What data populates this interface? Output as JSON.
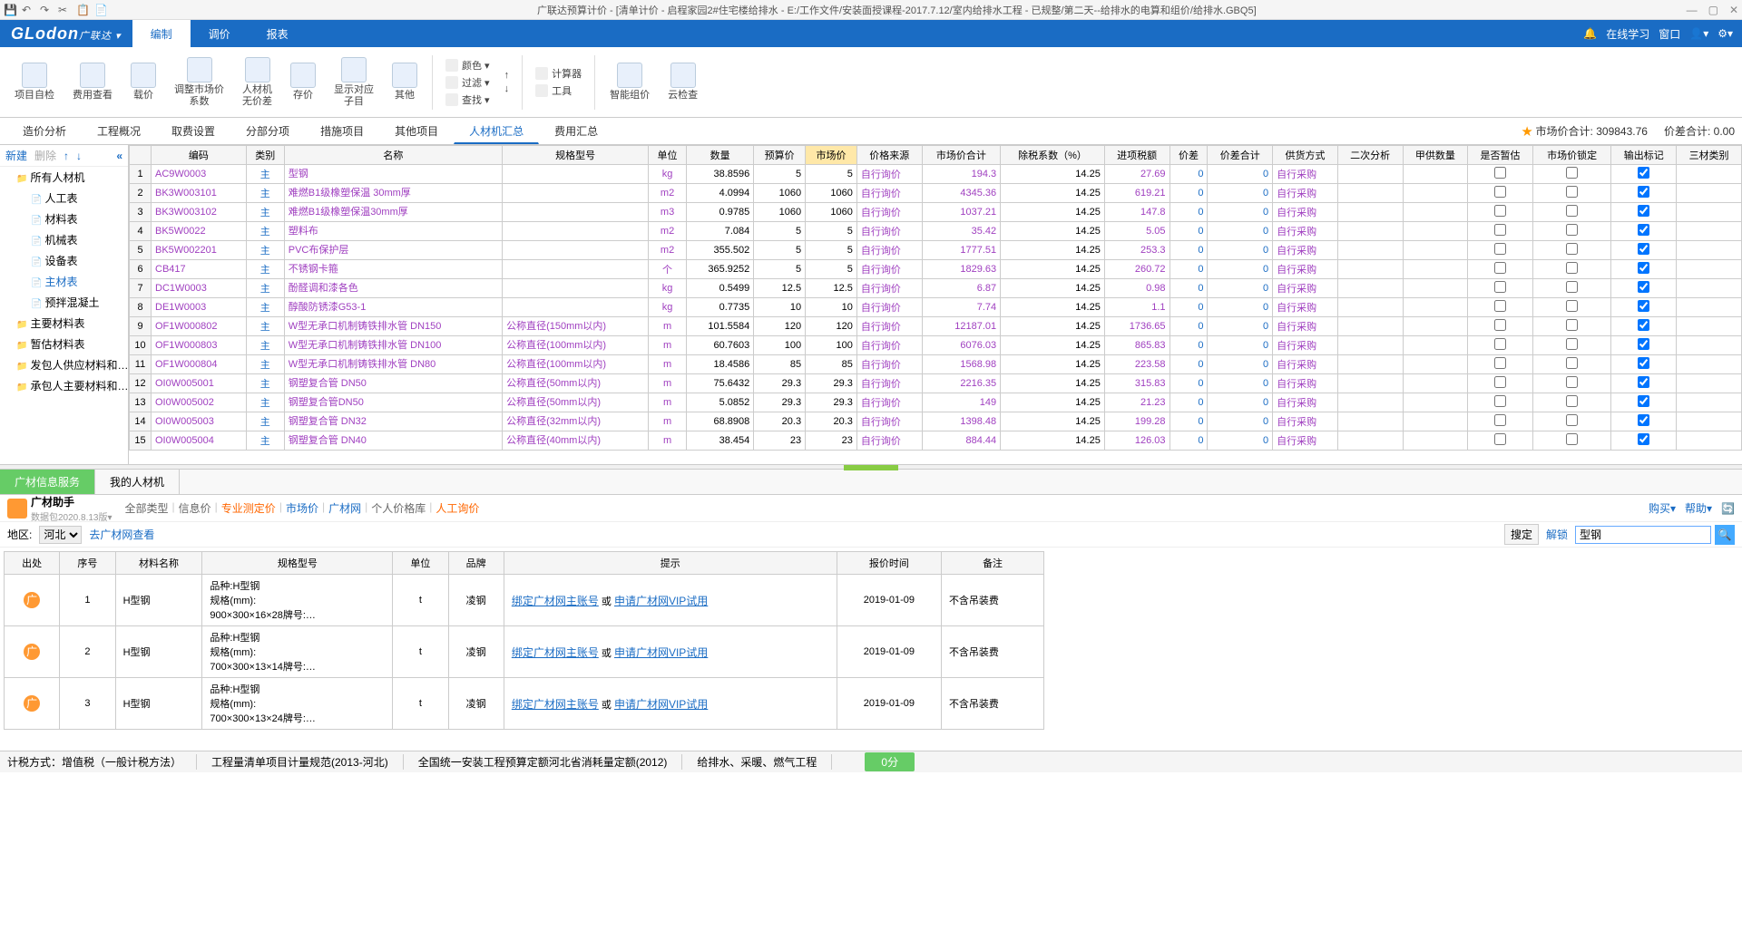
{
  "titlebar": {
    "title": "广联达预算计价 - [清单计价 - 启程家园2#住宅楼给排水 - E:/工作文件/安装面授课程-2017.7.12/室内给排水工程 - 已规整/第二天--给排水的电算和组价/给排水.GBQ5]"
  },
  "menu": {
    "tabs": [
      "编制",
      "调价",
      "报表"
    ],
    "active": 0,
    "right": {
      "online": "在线学习",
      "window": "窗口",
      "dropdown": "▾"
    }
  },
  "ribbon": {
    "buttons": [
      {
        "label": "项目自检"
      },
      {
        "label": "费用查看"
      },
      {
        "label": "载价"
      },
      {
        "label": "调整市场价\n系数"
      },
      {
        "label": "人材机\n无价差"
      },
      {
        "label": "存价"
      },
      {
        "label": "显示对应\n子目"
      },
      {
        "label": "其他"
      }
    ],
    "group2": [
      {
        "label": "颜色"
      },
      {
        "label": "过滤"
      },
      {
        "label": "查找"
      }
    ],
    "group3": [
      {
        "label": "计算器"
      },
      {
        "label": "工具"
      }
    ],
    "group4": [
      {
        "label": "智能组价"
      },
      {
        "label": "云检查"
      }
    ]
  },
  "subtabs": {
    "items": [
      "造价分析",
      "工程概况",
      "取费设置",
      "分部分项",
      "措施项目",
      "其他项目",
      "人材机汇总",
      "费用汇总"
    ],
    "active": 6,
    "totals": {
      "market_label": "市场价合计:",
      "market_value": "309843.76",
      "diff_label": "价差合计:",
      "diff_value": "0.00"
    }
  },
  "tree": {
    "toolbar": {
      "new": "新建",
      "del": "删除"
    },
    "nodes": [
      {
        "label": "所有人材机",
        "lvl": 0,
        "folder": true
      },
      {
        "label": "人工表",
        "lvl": 1
      },
      {
        "label": "材料表",
        "lvl": 1
      },
      {
        "label": "机械表",
        "lvl": 1
      },
      {
        "label": "设备表",
        "lvl": 1
      },
      {
        "label": "主材表",
        "lvl": 1,
        "active": true
      },
      {
        "label": "预拌混凝土",
        "lvl": 1
      },
      {
        "label": "主要材料表",
        "lvl": 0,
        "folder": true
      },
      {
        "label": "暂估材料表",
        "lvl": 0,
        "folder": true
      },
      {
        "label": "发包人供应材料和…",
        "lvl": 0,
        "folder": true
      },
      {
        "label": "承包人主要材料和…",
        "lvl": 0,
        "folder": true
      }
    ]
  },
  "grid": {
    "headers": [
      "编码",
      "类别",
      "名称",
      "规格型号",
      "单位",
      "数量",
      "预算价",
      "市场价",
      "价格来源",
      "市场价合计",
      "除税系数（%）",
      "进项税额",
      "价差",
      "价差合计",
      "供货方式",
      "二次分析",
      "甲供数量",
      "是否暂估",
      "市场价锁定",
      "输出标记",
      "三材类别"
    ],
    "hilite_col": 7,
    "rows": [
      {
        "n": 1,
        "code": "AC9W0003",
        "cat": "主",
        "name": "型钢",
        "spec": "",
        "unit": "kg",
        "qty": "38.8596",
        "bud": "5",
        "mkt": "5",
        "src": "自行询价",
        "total": "194.3",
        "tax": "14.25",
        "intax": "27.69",
        "diff": "0",
        "difftot": "0",
        "supply": "自行采购",
        "out": true
      },
      {
        "n": 2,
        "code": "BK3W003101",
        "cat": "主",
        "name": "难燃B1级橡塑保温 30mm厚",
        "spec": "",
        "unit": "m2",
        "qty": "4.0994",
        "bud": "1060",
        "mkt": "1060",
        "src": "自行询价",
        "total": "4345.36",
        "tax": "14.25",
        "intax": "619.21",
        "diff": "0",
        "difftot": "0",
        "supply": "自行采购",
        "out": true
      },
      {
        "n": 3,
        "code": "BK3W003102",
        "cat": "主",
        "name": "难燃B1级橡塑保温30mm厚",
        "spec": "",
        "unit": "m3",
        "qty": "0.9785",
        "bud": "1060",
        "mkt": "1060",
        "src": "自行询价",
        "total": "1037.21",
        "tax": "14.25",
        "intax": "147.8",
        "diff": "0",
        "difftot": "0",
        "supply": "自行采购",
        "out": true
      },
      {
        "n": 4,
        "code": "BK5W0022",
        "cat": "主",
        "name": "塑料布",
        "spec": "",
        "unit": "m2",
        "qty": "7.084",
        "bud": "5",
        "mkt": "5",
        "src": "自行询价",
        "total": "35.42",
        "tax": "14.25",
        "intax": "5.05",
        "diff": "0",
        "difftot": "0",
        "supply": "自行采购",
        "out": true
      },
      {
        "n": 5,
        "code": "BK5W002201",
        "cat": "主",
        "name": "PVC布保护层",
        "spec": "",
        "unit": "m2",
        "qty": "355.502",
        "bud": "5",
        "mkt": "5",
        "src": "自行询价",
        "total": "1777.51",
        "tax": "14.25",
        "intax": "253.3",
        "diff": "0",
        "difftot": "0",
        "supply": "自行采购",
        "out": true
      },
      {
        "n": 6,
        "code": "CB417",
        "cat": "主",
        "name": "不锈钢卡箍",
        "spec": "",
        "unit": "个",
        "qty": "365.9252",
        "bud": "5",
        "mkt": "5",
        "src": "自行询价",
        "total": "1829.63",
        "tax": "14.25",
        "intax": "260.72",
        "diff": "0",
        "difftot": "0",
        "supply": "自行采购",
        "out": true
      },
      {
        "n": 7,
        "code": "DC1W0003",
        "cat": "主",
        "name": "酚醛调和漆各色",
        "spec": "",
        "unit": "kg",
        "qty": "0.5499",
        "bud": "12.5",
        "mkt": "12.5",
        "src": "自行询价",
        "total": "6.87",
        "tax": "14.25",
        "intax": "0.98",
        "diff": "0",
        "difftot": "0",
        "supply": "自行采购",
        "out": true
      },
      {
        "n": 8,
        "code": "DE1W0003",
        "cat": "主",
        "name": "醇酸防锈漆G53-1",
        "spec": "",
        "unit": "kg",
        "qty": "0.7735",
        "bud": "10",
        "mkt": "10",
        "src": "自行询价",
        "total": "7.74",
        "tax": "14.25",
        "intax": "1.1",
        "diff": "0",
        "difftot": "0",
        "supply": "自行采购",
        "out": true
      },
      {
        "n": 9,
        "code": "OF1W000802",
        "cat": "主",
        "name": "W型无承口机制铸铁排水管 DN150",
        "spec": "公称直径(150mm以内)",
        "unit": "m",
        "qty": "101.5584",
        "bud": "120",
        "mkt": "120",
        "src": "自行询价",
        "total": "12187.01",
        "tax": "14.25",
        "intax": "1736.65",
        "diff": "0",
        "difftot": "0",
        "supply": "自行采购",
        "out": true
      },
      {
        "n": 10,
        "code": "OF1W000803",
        "cat": "主",
        "name": "W型无承口机制铸铁排水管 DN100",
        "spec": "公称直径(100mm以内)",
        "unit": "m",
        "qty": "60.7603",
        "bud": "100",
        "mkt": "100",
        "src": "自行询价",
        "total": "6076.03",
        "tax": "14.25",
        "intax": "865.83",
        "diff": "0",
        "difftot": "0",
        "supply": "自行采购",
        "out": true
      },
      {
        "n": 11,
        "code": "OF1W000804",
        "cat": "主",
        "name": "W型无承口机制铸铁排水管 DN80",
        "spec": "公称直径(100mm以内)",
        "unit": "m",
        "qty": "18.4586",
        "bud": "85",
        "mkt": "85",
        "src": "自行询价",
        "total": "1568.98",
        "tax": "14.25",
        "intax": "223.58",
        "diff": "0",
        "difftot": "0",
        "supply": "自行采购",
        "out": true
      },
      {
        "n": 12,
        "code": "OI0W005001",
        "cat": "主",
        "name": "钢塑复合管 DN50",
        "spec": "公称直径(50mm以内)",
        "unit": "m",
        "qty": "75.6432",
        "bud": "29.3",
        "mkt": "29.3",
        "src": "自行询价",
        "total": "2216.35",
        "tax": "14.25",
        "intax": "315.83",
        "diff": "0",
        "difftot": "0",
        "supply": "自行采购",
        "out": true
      },
      {
        "n": 13,
        "code": "OI0W005002",
        "cat": "主",
        "name": "钢塑复合管DN50",
        "spec": "公称直径(50mm以内)",
        "unit": "m",
        "qty": "5.0852",
        "bud": "29.3",
        "mkt": "29.3",
        "src": "自行询价",
        "total": "149",
        "tax": "14.25",
        "intax": "21.23",
        "diff": "0",
        "difftot": "0",
        "supply": "自行采购",
        "out": true
      },
      {
        "n": 14,
        "code": "OI0W005003",
        "cat": "主",
        "name": "钢塑复合管 DN32",
        "spec": "公称直径(32mm以内)",
        "unit": "m",
        "qty": "68.8908",
        "bud": "20.3",
        "mkt": "20.3",
        "src": "自行询价",
        "total": "1398.48",
        "tax": "14.25",
        "intax": "199.28",
        "diff": "0",
        "difftot": "0",
        "supply": "自行采购",
        "out": true
      },
      {
        "n": 15,
        "code": "OI0W005004",
        "cat": "主",
        "name": "钢塑复合管 DN40",
        "spec": "公称直径(40mm以内)",
        "unit": "m",
        "qty": "38.454",
        "bud": "23",
        "mkt": "23",
        "src": "自行询价",
        "total": "884.44",
        "tax": "14.25",
        "intax": "126.03",
        "diff": "0",
        "difftot": "0",
        "supply": "自行采购",
        "out": true
      }
    ]
  },
  "bottom": {
    "tabs": [
      "广材信息服务",
      "我的人材机"
    ],
    "active": 0,
    "assist": {
      "title": "广材助手",
      "sub": "数据包2020.8.13版▾"
    },
    "filter_tabs": [
      "全部类型",
      "信息价",
      "专业测定价",
      "市场价",
      "广材网",
      "个人价格库",
      "人工询价"
    ],
    "filter_active": [
      3,
      4
    ],
    "right_tools": {
      "buy": "购买▾",
      "help": "帮助▾"
    },
    "region": {
      "label": "地区:",
      "value": "河北",
      "link": "去广材网查看"
    },
    "search": {
      "locate": "搜定",
      "unlock": "解锁",
      "value": "型钢"
    },
    "grid": {
      "headers": [
        "出处",
        "序号",
        "材料名称",
        "规格型号",
        "单位",
        "品牌",
        "提示",
        "报价时间",
        "备注"
      ],
      "rows": [
        {
          "seq": "1",
          "name": "H型钢",
          "spec": "品种:H型钢\n规格(mm):\n900×300×16×28牌号:…",
          "unit": "t",
          "brand": "凌钢",
          "tip_a": "绑定广材网主账号",
          "tip_or": " 或 ",
          "tip_b": "申请广材网VIP试用",
          "time": "2019-01-09",
          "note": "不含吊装费"
        },
        {
          "seq": "2",
          "name": "H型钢",
          "spec": "品种:H型钢\n规格(mm):\n700×300×13×14牌号:…",
          "unit": "t",
          "brand": "凌钢",
          "tip_a": "绑定广材网主账号",
          "tip_or": " 或 ",
          "tip_b": "申请广材网VIP试用",
          "time": "2019-01-09",
          "note": "不含吊装费"
        },
        {
          "seq": "3",
          "name": "H型钢",
          "spec": "品种:H型钢\n规格(mm):\n700×300×13×24牌号:…",
          "unit": "t",
          "brand": "凌钢",
          "tip_a": "绑定广材网主账号",
          "tip_or": " 或 ",
          "tip_b": "申请广材网VIP试用",
          "time": "2019-01-09",
          "note": "不含吊装费"
        }
      ]
    }
  },
  "status": {
    "tax": "计税方式：增值税（一般计税方法）",
    "quota1": "工程量清单项目计量规范(2013-河北)",
    "quota2": "全国统一安装工程预算定额河北省消耗量定额(2012)",
    "proj": "给排水、采暖、燃气工程",
    "score": "0分"
  }
}
